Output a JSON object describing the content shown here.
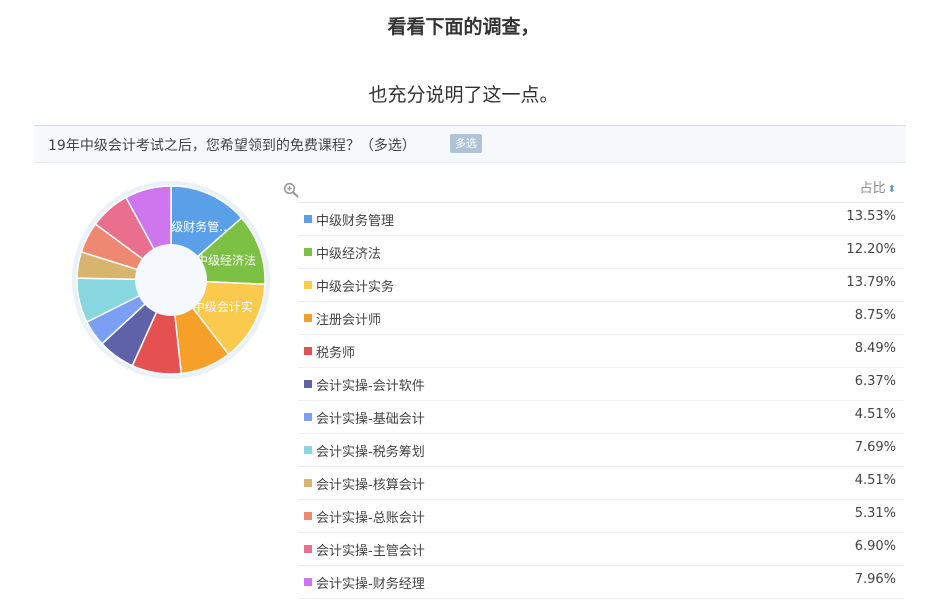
{
  "headline": "看看下面的调查，",
  "subline": "也充分说明了这一点。",
  "survey": {
    "question": "19年中级会计考试之后，您希望领到的免费课程？（多选）",
    "tag": "多选",
    "column_header": "占比",
    "sort_icon": "sort-arrows-icon",
    "zoom_icon": "zoom-in-icon"
  },
  "chart_data": {
    "type": "pie",
    "title": "",
    "donut": true,
    "inner_labels": [
      "中级财务管...",
      "中级经济法",
      "中级会计实"
    ],
    "labels": [
      "中级财务管理",
      "中级经济法",
      "中级会计实务",
      "注册会计师",
      "税务师",
      "会计实操-会计软件",
      "会计实操-基础会计",
      "会计实操-税务筹划",
      "会计实操-核算会计",
      "会计实操-总账会计",
      "会计实操-主管会计",
      "会计实操-财务经理"
    ],
    "values": [
      13.53,
      12.2,
      13.79,
      8.75,
      8.49,
      6.37,
      4.51,
      7.69,
      4.51,
      5.31,
      6.9,
      7.96
    ],
    "value_labels": [
      "13.53%",
      "12.20%",
      "13.79%",
      "8.75%",
      "8.49%",
      "6.37%",
      "4.51%",
      "7.69%",
      "4.51%",
      "5.31%",
      "6.90%",
      "7.96%"
    ],
    "colors": [
      "#5aa0e8",
      "#7cc144",
      "#fac94e",
      "#f6a02a",
      "#e55050",
      "#5f62a8",
      "#7b9ff2",
      "#88d6e0",
      "#d8b46e",
      "#ee8870",
      "#ea6e8e",
      "#cf75ee"
    ],
    "legend": "right-table"
  }
}
